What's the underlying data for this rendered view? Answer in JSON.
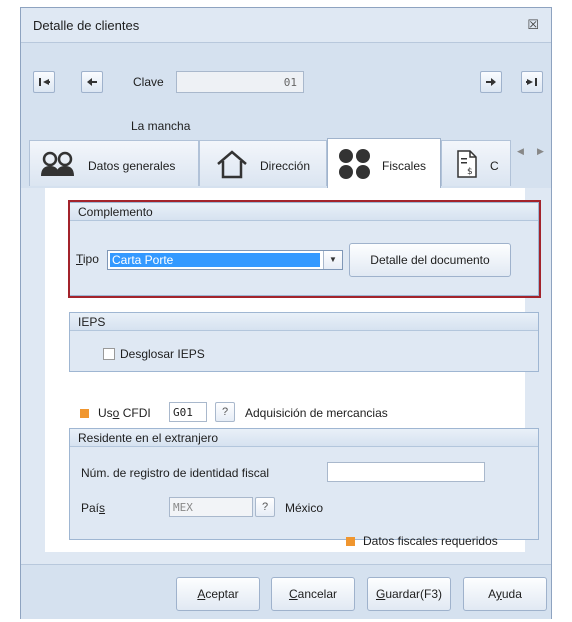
{
  "window": {
    "title": "Detalle de clientes",
    "close_glyph": "☒"
  },
  "nav": {
    "clave_label": "Clave",
    "clave_value": "01",
    "client_name": "La mancha"
  },
  "tabs": [
    {
      "label": "Datos generales",
      "icon": "people-icon"
    },
    {
      "label": "Dirección",
      "icon": "house-icon"
    },
    {
      "label": "Fiscales",
      "icon": "dots-icon"
    },
    {
      "label": "C",
      "icon": "invoice-icon"
    }
  ],
  "complemento": {
    "title": "Complemento",
    "tipo_label_u": "T",
    "tipo_label_rest": "ipo",
    "tipo_value": "Carta Porte",
    "detalle_button": "Detalle del documento"
  },
  "ieps": {
    "title": "IEPS",
    "checkbox_label": "Desglosar IEPS",
    "checked": false
  },
  "uso_cfdi": {
    "label_pre": "Us",
    "label_u": "o",
    "label_post": " CFDI",
    "code": "G01",
    "description": "Adquisición de mercancias"
  },
  "residente": {
    "title": "Residente en el extranjero",
    "registro_label": "Núm. de registro de identidad fiscal",
    "registro_value": "",
    "pais_label_pre": "Paí",
    "pais_label_u": "s",
    "pais_code": "MEX",
    "pais_name": "México"
  },
  "legend": {
    "text": "Datos fiscales requeridos",
    "color": "#f0962f"
  },
  "footer": {
    "aceptar_u": "A",
    "aceptar_rest": "ceptar",
    "cancelar_u": "C",
    "cancelar_rest": "ancelar",
    "guardar_u": "G",
    "guardar_rest": "uardar(F3)",
    "ayuda_pre": "A",
    "ayuda_u": "y",
    "ayuda_rest": "uda"
  },
  "colors": {
    "accent": "#3399ff",
    "highlight": "#a3232b",
    "panel": "#dfe8f3"
  }
}
